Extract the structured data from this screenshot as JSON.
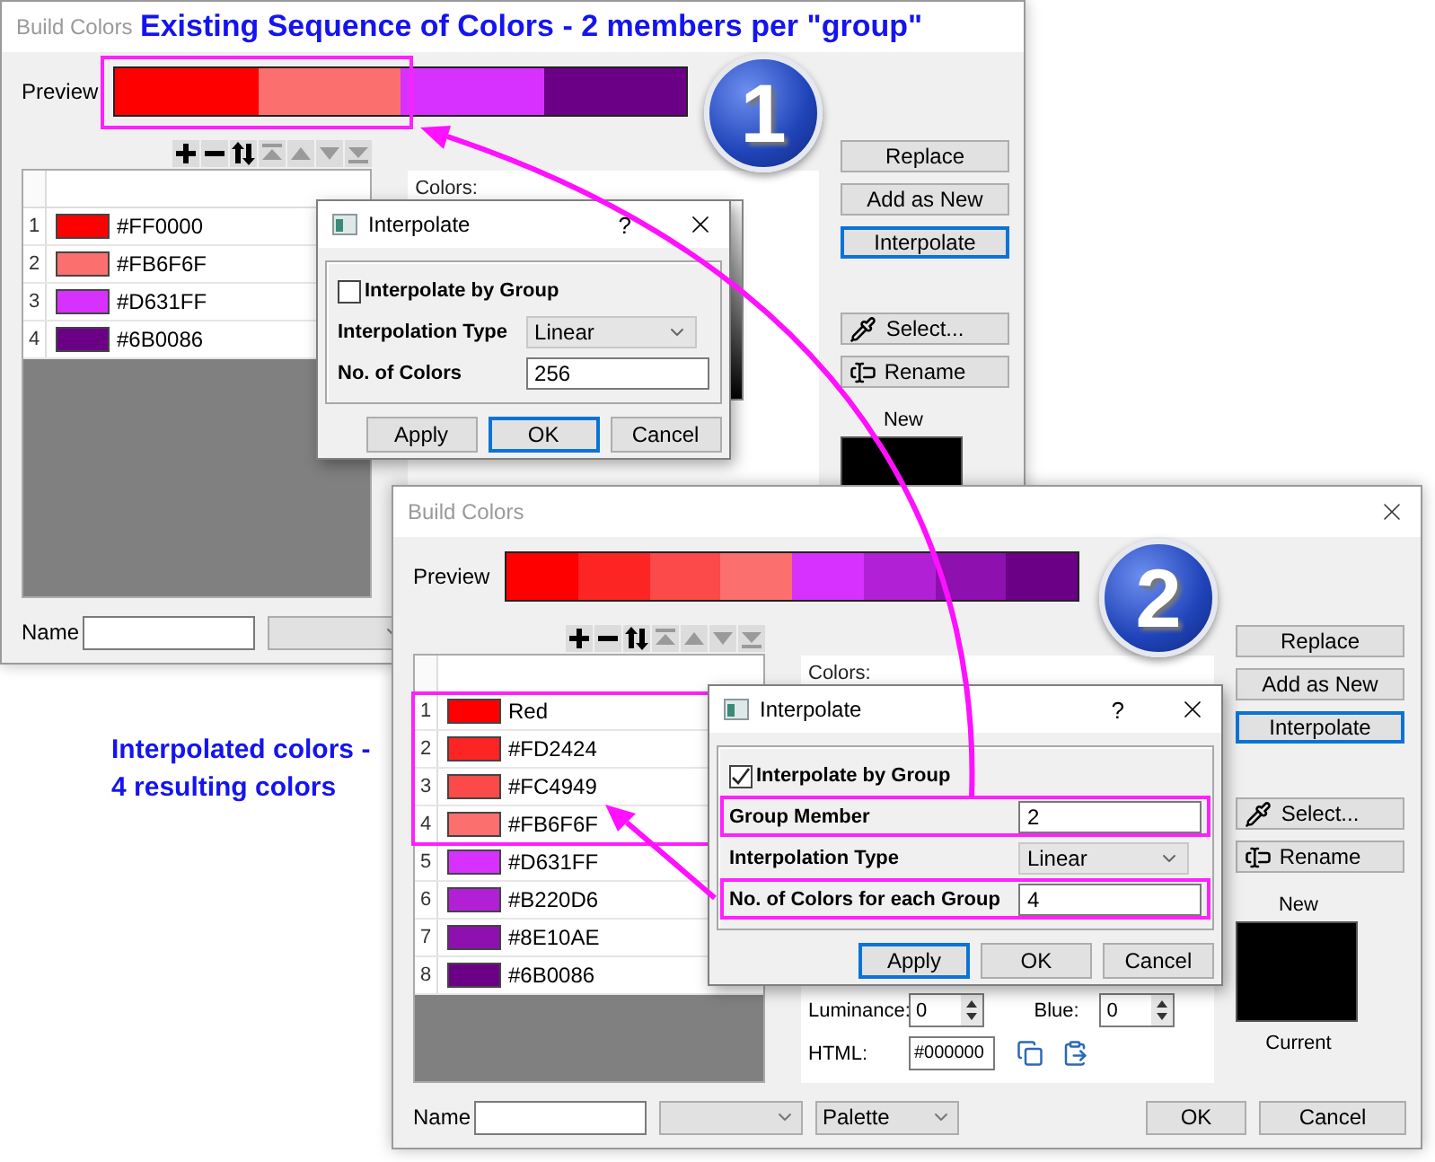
{
  "annotations": [
    {
      "lines": [
        "Existing Sequence of Colors - 2 members per \"group\""
      ]
    },
    {
      "lines": [
        "Interpolated colors -",
        "4 resulting colors"
      ]
    }
  ],
  "badges": [
    {
      "label": "1"
    },
    {
      "label": "2"
    }
  ],
  "windows": [
    {
      "title": "Build Colors",
      "close_button": false,
      "preview": {
        "label": "Preview",
        "segments": [
          {
            "color": "#ff0000"
          },
          {
            "color": "#fb6f6f"
          },
          {
            "color": "#d631ff"
          },
          {
            "color": "#6b0086"
          }
        ]
      },
      "toolbar": [
        {
          "kind": "add",
          "disabled": false
        },
        {
          "kind": "remove",
          "disabled": false
        },
        {
          "kind": "reverse",
          "disabled": false
        },
        {
          "kind": "top",
          "disabled": true
        },
        {
          "kind": "up",
          "disabled": true
        },
        {
          "kind": "down",
          "disabled": true
        },
        {
          "kind": "bottom",
          "disabled": true
        }
      ],
      "rows": [
        {
          "number": "1",
          "name": "#FF0000",
          "color": "#ff0000",
          "highlighted": false
        },
        {
          "number": "2",
          "name": "#FB6F6F",
          "color": "#fb6f6f",
          "highlighted": false
        },
        {
          "number": "3",
          "name": "#D631FF",
          "color": "#d631ff",
          "highlighted": false
        },
        {
          "number": "4",
          "name": "#6B0086",
          "color": "#6b0086",
          "highlighted": false
        }
      ],
      "colors_panel": {
        "label": "Colors:"
      },
      "side_buttons": [
        {
          "label": "Replace",
          "kind": "plain",
          "focused": false
        },
        {
          "label": "Add as New",
          "kind": "plain",
          "focused": false
        },
        {
          "label": "Interpolate",
          "kind": "plain",
          "focused": true
        },
        {
          "label": "Select...",
          "kind": "eyedropper",
          "focused": false
        },
        {
          "label": "Rename",
          "kind": "rename",
          "focused": false
        }
      ],
      "swatch": {
        "label": "New",
        "color": "#000000"
      },
      "bottom": {
        "name_label": "Name",
        "selects": [
          {
            "kind": "blank"
          }
        ]
      },
      "dialog": {
        "title": "Interpolate",
        "help": "?",
        "checkbox": {
          "label": "Interpolate by Group",
          "checked": false
        },
        "fields": [
          {
            "kind": "select",
            "label": "Interpolation Type",
            "value": "Linear",
            "highlighted": false
          },
          {
            "kind": "input",
            "label": "No. of Colors",
            "value": "256",
            "highlighted": false
          }
        ],
        "buttons": [
          {
            "label": "Apply",
            "focused": false
          },
          {
            "label": "OK",
            "focused": true
          },
          {
            "label": "Cancel",
            "focused": false
          }
        ]
      }
    },
    {
      "title": "Build Colors",
      "close_button": true,
      "preview": {
        "label": "Preview",
        "segments": [
          {
            "color": "#ff0000"
          },
          {
            "color": "#fd2424"
          },
          {
            "color": "#fc4949"
          },
          {
            "color": "#fb6f6f"
          },
          {
            "color": "#d631ff"
          },
          {
            "color": "#b220d6"
          },
          {
            "color": "#8e10ae"
          },
          {
            "color": "#6b0086"
          }
        ]
      },
      "toolbar": [
        {
          "kind": "add",
          "disabled": false
        },
        {
          "kind": "remove",
          "disabled": false
        },
        {
          "kind": "reverse",
          "disabled": false
        },
        {
          "kind": "top",
          "disabled": true
        },
        {
          "kind": "up",
          "disabled": true
        },
        {
          "kind": "down",
          "disabled": true
        },
        {
          "kind": "bottom",
          "disabled": true
        }
      ],
      "rows": [
        {
          "number": "1",
          "name": "Red",
          "color": "#ff0000",
          "highlighted": true
        },
        {
          "number": "2",
          "name": "#FD2424",
          "color": "#fd2424",
          "highlighted": true
        },
        {
          "number": "3",
          "name": "#FC4949",
          "color": "#fc4949",
          "highlighted": true
        },
        {
          "number": "4",
          "name": "#FB6F6F",
          "color": "#fb6f6f",
          "highlighted": true
        },
        {
          "number": "5",
          "name": "#D631FF",
          "color": "#d631ff",
          "highlighted": false
        },
        {
          "number": "6",
          "name": "#B220D6",
          "color": "#b220d6",
          "highlighted": false
        },
        {
          "number": "7",
          "name": "#8E10AE",
          "color": "#8e10ae",
          "highlighted": false
        },
        {
          "number": "8",
          "name": "#6B0086",
          "color": "#6b0086",
          "highlighted": false
        }
      ],
      "colors_panel": {
        "label": "Colors:",
        "spin_fields": [
          {
            "label": "Luminance:",
            "value": "0"
          },
          {
            "label": "Blue:",
            "value": "0"
          }
        ],
        "html_field": {
          "label": "HTML:",
          "value": "#000000"
        }
      },
      "side_buttons": [
        {
          "label": "Replace",
          "kind": "plain",
          "focused": false
        },
        {
          "label": "Add as New",
          "kind": "plain",
          "focused": false
        },
        {
          "label": "Interpolate",
          "kind": "plain",
          "focused": true
        },
        {
          "label": "Select...",
          "kind": "eyedropper",
          "focused": false
        },
        {
          "label": "Rename",
          "kind": "rename",
          "focused": false
        }
      ],
      "swatch": {
        "label": "New",
        "color": "#000000",
        "caption": "Current"
      },
      "bottom": {
        "name_label": "Name",
        "selects": [
          {
            "kind": "blank"
          },
          {
            "kind": "text",
            "value": "Palette"
          }
        ],
        "buttons": [
          "OK",
          "Cancel"
        ]
      },
      "dialog": {
        "title": "Interpolate",
        "help": "?",
        "checkbox": {
          "label": "Interpolate by Group",
          "checked": true
        },
        "fields": [
          {
            "kind": "input",
            "label": "Group Member",
            "value": "2",
            "highlighted": true
          },
          {
            "kind": "select",
            "label": "Interpolation Type",
            "value": "Linear",
            "highlighted": false
          },
          {
            "kind": "input",
            "label": "No. of Colors for each Group",
            "value": "4",
            "highlighted": true
          }
        ],
        "buttons": [
          {
            "label": "Apply",
            "focused": true
          },
          {
            "label": "OK",
            "focused": false
          },
          {
            "label": "Cancel",
            "focused": false
          }
        ]
      }
    }
  ]
}
